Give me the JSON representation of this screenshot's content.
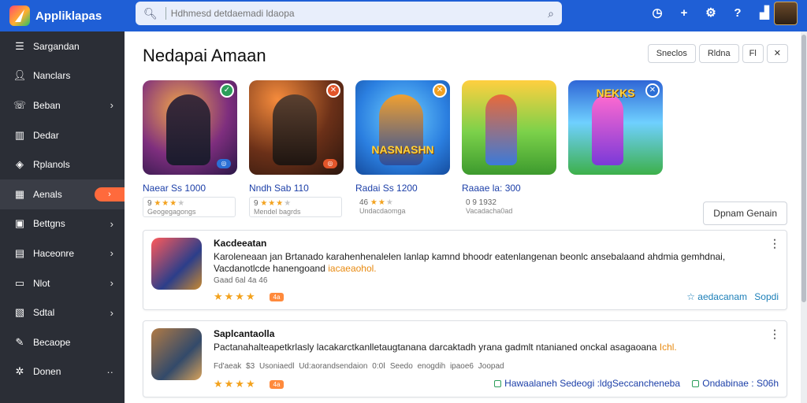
{
  "app": {
    "logo_text": "Appliklapas"
  },
  "search": {
    "placeholder": "Hdhmesd detdaemadi ldaopa"
  },
  "top_icons": [
    "clock-icon",
    "plus-icon",
    "gear-icon",
    "help-icon",
    "chart-icon"
  ],
  "sidebar": {
    "items": [
      {
        "label": "Sargandan",
        "icon": "menu-icon",
        "chevron": false
      },
      {
        "label": "Nanclars",
        "icon": "user-icon",
        "chevron": false
      },
      {
        "label": "Beban",
        "icon": "phone-icon",
        "chevron": true
      },
      {
        "label": "Dedar",
        "icon": "book-icon",
        "chevron": false
      },
      {
        "label": "Rplanols",
        "icon": "tag-icon",
        "chevron": false
      },
      {
        "label": "Aenals",
        "icon": "chart-icon",
        "chevron": true,
        "active": true
      },
      {
        "label": "Bettgns",
        "icon": "image-icon",
        "chevron": true
      },
      {
        "label": "Haceonre",
        "icon": "calendar-icon",
        "chevron": true
      },
      {
        "label": "Nlot",
        "icon": "list-icon",
        "chevron": true
      },
      {
        "label": "Sdtal",
        "icon": "grid-icon",
        "chevron": true
      },
      {
        "label": "Becaope",
        "icon": "gift-icon",
        "chevron": false
      },
      {
        "label": "Donen",
        "icon": "settings-icon",
        "chevron": false,
        "dots": "··"
      }
    ]
  },
  "main": {
    "title": "Nedapai  Amaan",
    "buttons": [
      "Sneclos",
      "Rldna",
      "Fl",
      "✕"
    ],
    "compare_button": "Dpnam Genain",
    "games": [
      {
        "name": "Naear  Ss 1000",
        "meta_top": "9",
        "stars": 3,
        "meta_sub": "Geogegagongs",
        "title_art": ""
      },
      {
        "name": "Nndh  Sab  110",
        "meta_top": "9",
        "stars": 3,
        "meta_sub": "Mendel bagrds",
        "title_art": ""
      },
      {
        "name": "Radai  Ss  1200",
        "meta_top": "46",
        "stars": 3,
        "meta_sub": "Undacdaomga",
        "title_art": "NASNASHN"
      },
      {
        "name": "Raaae  la:  300",
        "meta_top": "0 9 1932",
        "stars": 0,
        "meta_sub": "Vacadacha0ad",
        "title_art": ""
      },
      {
        "name": "",
        "meta_top": "",
        "stars": 0,
        "meta_sub": "",
        "title_art": "NEKKS"
      }
    ],
    "list": [
      {
        "title": "Kacdeeatan",
        "desc": "Karoleneaan  jan  Brtanado  karahenhenalelen  lanlap kamnd  bhoodr  eatenlangenan  beonlc  ansebalaand  ahdmia gemhdnai,  Vacdanotlcde  hanengoand",
        "desc_hl": "iacaeaohol.",
        "meta": "Gaad 6al  4a  46",
        "stars": "★★★★",
        "tag": "4a",
        "link_a": "☆ aedacanam",
        "link_b": "Sopdi"
      },
      {
        "title": "Saplcantaolla",
        "desc": "Pactanahalteapetkrlasly lacakarctkanlletaugtanana  darcaktadh  yrana gadmlt  ntanianed onckal  asagaoana",
        "desc_hl": "Ichl.",
        "meta": "Fd'aeak  $3   Usoniaedl   Ud:aorandsendaion           0:0Ⅰ Seedo enogdih   ipaoe6 Joopad",
        "stars": "★★★★",
        "tag": "4a",
        "link_a": "Hawaalaneh Sedeogi :ldgSeccancheneba",
        "link_b": "Ondabinae  :  S06h"
      }
    ]
  },
  "colors": {
    "topbar": "#1f5fd6",
    "sidebar": "#2b2e36",
    "accent": "#ff6a3c",
    "star": "#f3a21d"
  }
}
